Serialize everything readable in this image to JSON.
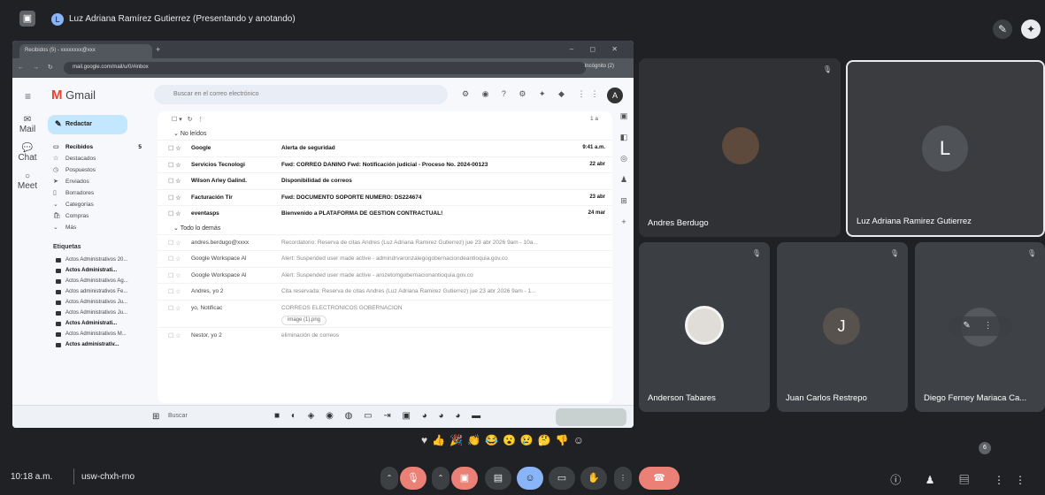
{
  "meet": {
    "presenter_initial": "L",
    "presenter_title": "Luz Adriana Ramírez Gutierrez (Presentando y anotando)",
    "time": "10:18 a.m.",
    "meeting_code": "usw-chxh-rno",
    "reactions": [
      "♥",
      "👍",
      "🎉",
      "👏",
      "😂",
      "😮",
      "😢",
      "🤔",
      "👎",
      "☺"
    ],
    "participant_count": "6"
  },
  "chrome": {
    "tab_title": "Recibidos (5) - xxxxxxxx@xxx",
    "url": "mail.google.com/mail/u/0/#inbox",
    "incognito_label": "Incógnito (2)"
  },
  "gmail": {
    "logo": "Gmail",
    "search_placeholder": "Buscar en el correo electrónico",
    "compose_label": "Redactar",
    "avatar_initial": "A",
    "list_count": "1 a",
    "rail": [
      {
        "icon": "✉",
        "label": "Mail"
      },
      {
        "icon": "💬",
        "label": "Chat"
      },
      {
        "icon": "○",
        "label": "Meet"
      }
    ],
    "nav": [
      {
        "icon": "▭",
        "label": "Recibidos",
        "count": "5",
        "active": true
      },
      {
        "icon": "☆",
        "label": "Destacados",
        "count": ""
      },
      {
        "icon": "◷",
        "label": "Pospuestos",
        "count": ""
      },
      {
        "icon": "➤",
        "label": "Enviados",
        "count": ""
      },
      {
        "icon": "▯",
        "label": "Borradores",
        "count": ""
      },
      {
        "icon": "⌄",
        "label": "Categorías",
        "count": ""
      },
      {
        "icon": "🛍",
        "label": "Compras",
        "count": ""
      },
      {
        "icon": "⌄",
        "label": "Más",
        "count": ""
      }
    ],
    "labels_header": "Etiquetas",
    "labels": [
      {
        "name": "Actos Administrativos 20...",
        "bold": false
      },
      {
        "name": "Actos Administrati...",
        "bold": true
      },
      {
        "name": "Actos Administrativos Ag...",
        "bold": false
      },
      {
        "name": "Actos administrativos Fe...",
        "bold": false
      },
      {
        "name": "Actos Administrativos Ju...",
        "bold": false
      },
      {
        "name": "Actos Administrativos Ju...",
        "bold": false
      },
      {
        "name": "Actos Administrati...",
        "bold": true
      },
      {
        "name": "Actos Administrativos M...",
        "bold": false
      },
      {
        "name": "Actos administrativ...",
        "bold": true
      }
    ],
    "section_unread": "No leídos",
    "section_rest": "Todo lo demás",
    "unread_rows": [
      {
        "sender": "Google",
        "subject": "Alerta de seguridad",
        "snippet": "",
        "date": "9:41 a.m."
      },
      {
        "sender": "Servicios Tecnologi",
        "subject": "Fwd: CORREO DAÑINO Fwd: Notificación judicial - Proceso No. 2024-00123",
        "snippet": "",
        "date": "22 abr"
      },
      {
        "sender": "Wilson Arley Galind.",
        "subject": "Disponibilidad de correos",
        "snippet": "",
        "date": ""
      },
      {
        "sender": "Facturación Tir",
        "subject": "Fwd: DOCUMENTO SOPORTE NUMERO: DS224674",
        "snippet": "",
        "date": "23 abr"
      },
      {
        "sender": "eventasps",
        "subject": "Bienvenido a PLATAFORMA DE GESTION CONTRACTUAL!",
        "snippet": "",
        "date": "24 mar"
      }
    ],
    "rest_rows": [
      {
        "sender": "andres.berdugo@xxxx",
        "subject": "",
        "snippet": "Recordatorio: Reserva de citas Andres (Luz Adriana Ramirez Gutierrez) jue 23 abr 2026 9am - 10a...",
        "date": ""
      },
      {
        "sender": "Google Workspace Al",
        "subject": "",
        "snippet": "Alert: Suspended user made active - admindrvaronzalegogobernaciondeantioquia.gov.co",
        "date": ""
      },
      {
        "sender": "Google Workspace Al",
        "subject": "",
        "snippet": "Alert: Suspended user made active - arozetomgobernacionantioquia.gov.co",
        "date": ""
      },
      {
        "sender": "Andres, yo 2",
        "subject": "",
        "snippet": "Cita reservada: Reserva de citas Andres (Luz Adriana Ramirez Gutierrez) jue 23 abr 2026 9am - 1...",
        "date": ""
      },
      {
        "sender": "yo, Notificac",
        "subject": "",
        "snippet": "CORREOS ELECTRONICOS GOBERNACION",
        "date": ""
      },
      {
        "sender": "Nestor, yo 2",
        "subject": "",
        "snippet": "eliminación de correos",
        "date": ""
      }
    ],
    "attachment_label": "image (1).png"
  },
  "participants": [
    {
      "name": "Andres Berdugo",
      "initial": ""
    },
    {
      "name": "Luz Adriana Ramirez Gutierrez",
      "initial": "L"
    },
    {
      "name": "Anderson Tabares",
      "initial": ""
    },
    {
      "name": "Juan Carlos Restrepo",
      "initial": "J"
    },
    {
      "name": "Diego Ferney Mariaca Ca...",
      "initial": ""
    }
  ],
  "taskbar": {
    "search": "Buscar"
  }
}
